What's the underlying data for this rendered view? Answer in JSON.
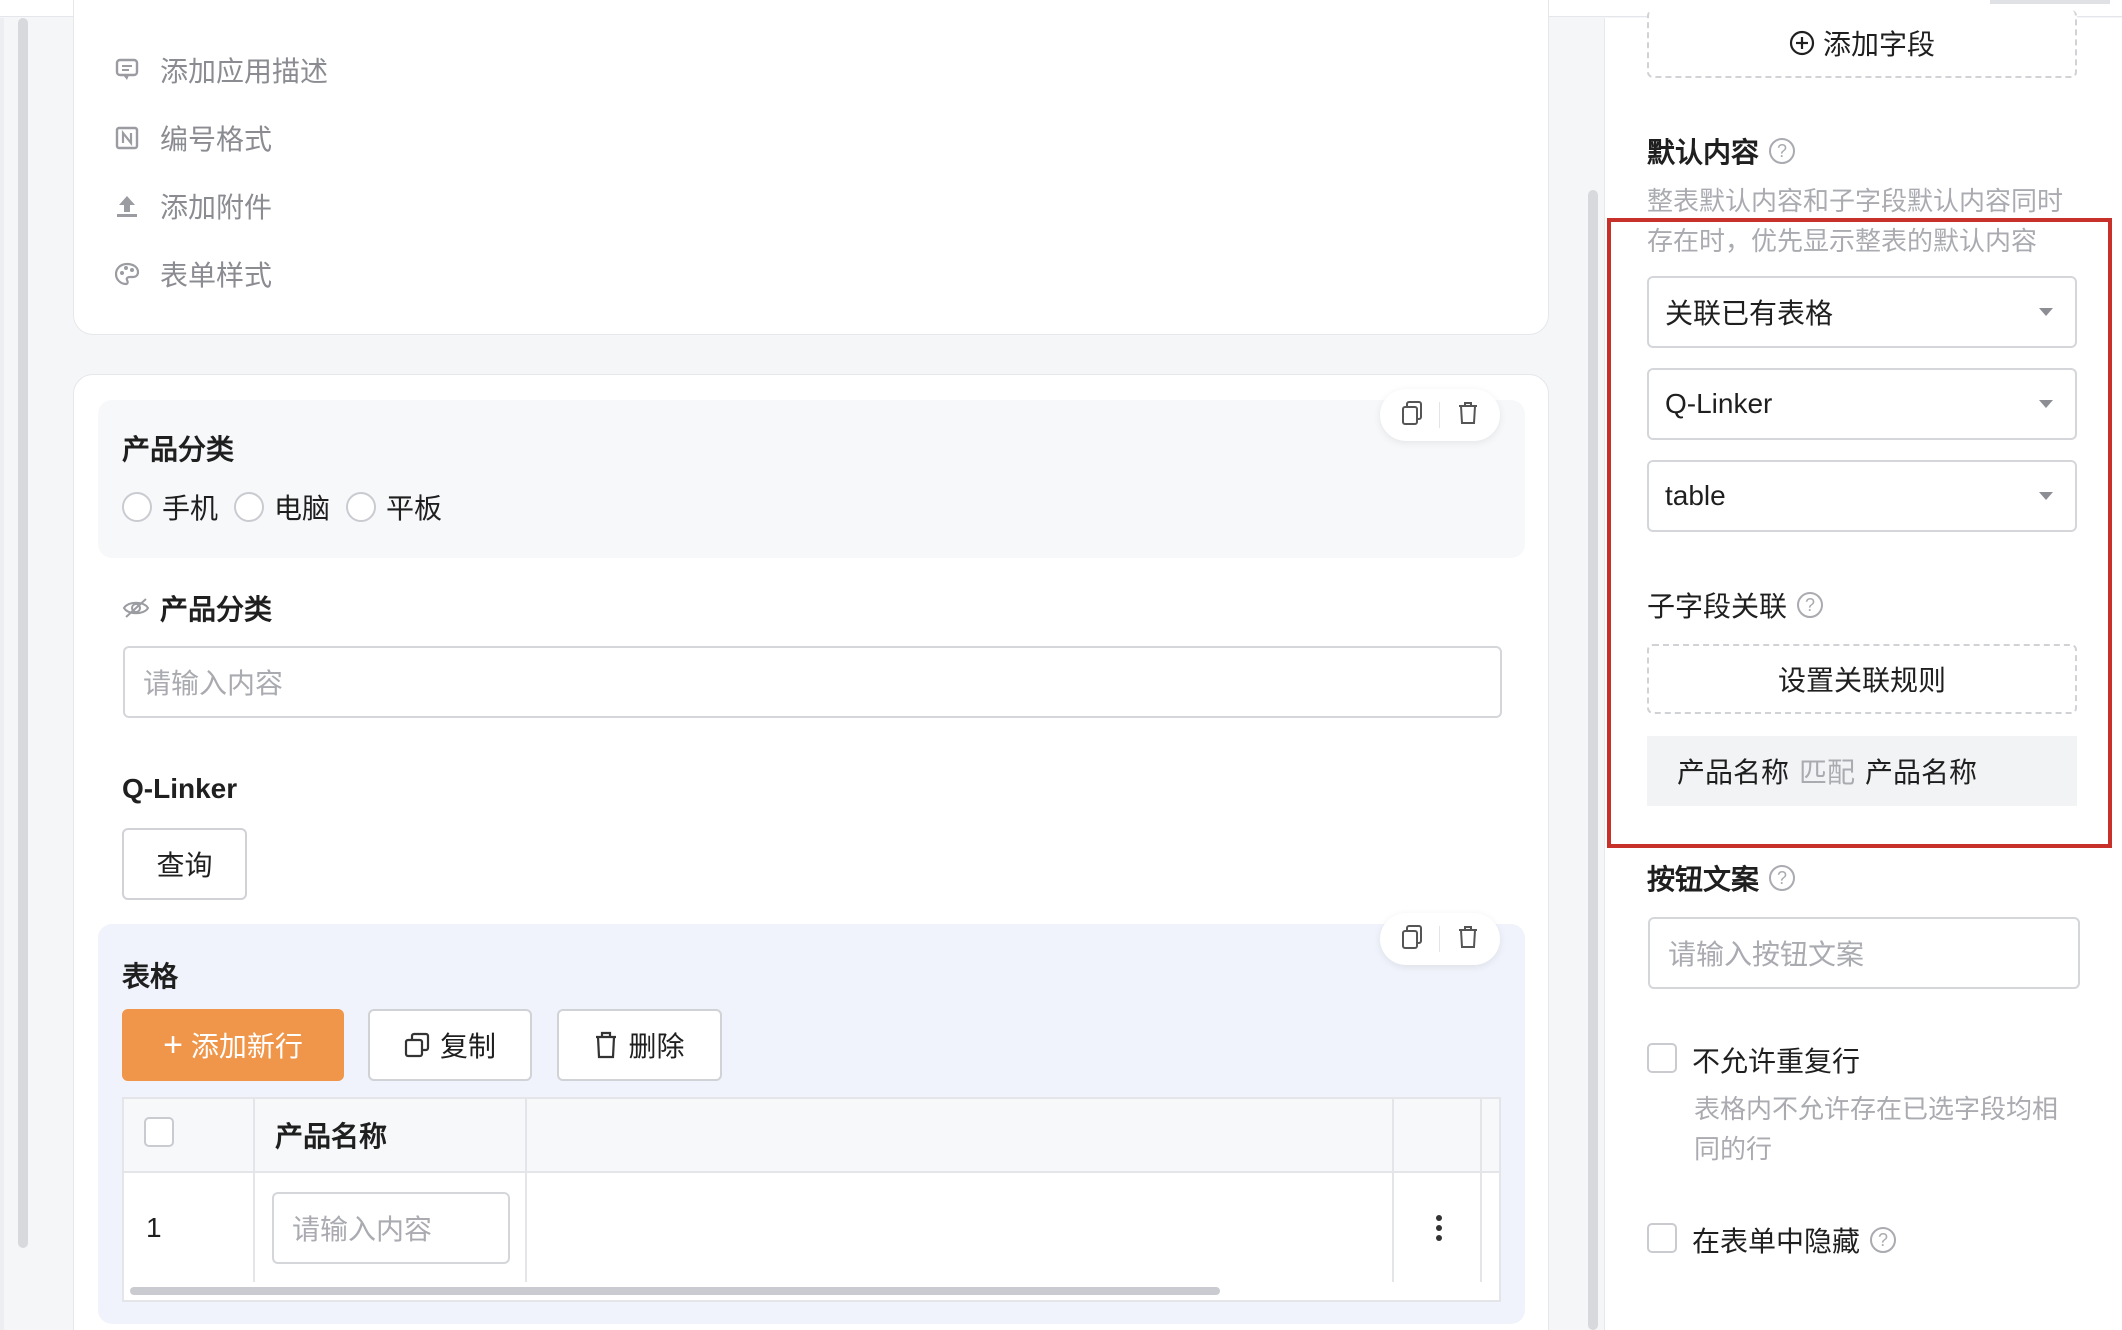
{
  "top_settings": {
    "items": [
      {
        "label": "添加应用描述",
        "icon": "comment-icon"
      },
      {
        "label": "编号格式",
        "icon": "numbering-icon"
      },
      {
        "label": "添加附件",
        "icon": "upload-icon"
      },
      {
        "label": "表单样式",
        "icon": "palette-icon"
      }
    ]
  },
  "form": {
    "product_category_radio": {
      "title": "产品分类",
      "options": [
        "手机",
        "电脑",
        "平板"
      ]
    },
    "product_category_text": {
      "title": "产品分类",
      "placeholder": "请输入内容"
    },
    "qlinker": {
      "title": "Q-Linker",
      "query_button": "查询"
    },
    "table": {
      "title": "表格",
      "add_row": "添加新行",
      "copy": "复制",
      "delete": "删除",
      "columns": [
        "产品名称"
      ],
      "rows": [
        {
          "index": "1",
          "placeholder": "请输入内容"
        }
      ]
    }
  },
  "right_panel": {
    "add_field": "添加字段",
    "default_content": {
      "title": "默认内容",
      "hint_line1": "整表默认内容和子字段默认内容同时",
      "hint_line2": "存在时，优先显示整表的默认内容",
      "select_source": "关联已有表格",
      "select_app": "Q-Linker",
      "select_table": "table"
    },
    "sub_field": {
      "title": "子字段关联",
      "set_rule": "设置关联规则",
      "rule_left": "产品名称",
      "rule_op": "匹配",
      "rule_right": "产品名称"
    },
    "button_text": {
      "title": "按钮文案",
      "placeholder": "请输入按钮文案"
    },
    "no_duplicate": {
      "label": "不允许重复行",
      "hint_line1": "表格内不允许存在已选字段均相",
      "hint_line2": "同的行"
    },
    "hide_in_form": {
      "label": "在表单中隐藏"
    }
  },
  "colors": {
    "accent": "#f0964a",
    "highlight": "#c8312a"
  }
}
